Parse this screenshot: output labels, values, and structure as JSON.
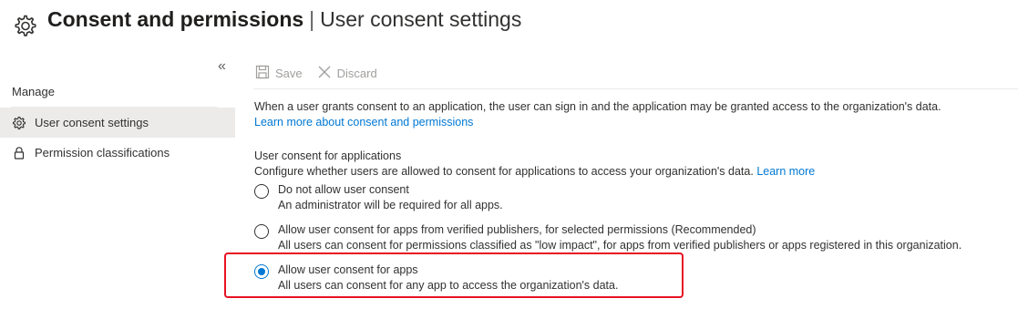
{
  "header": {
    "title": "Consent and permissions",
    "separator": "|",
    "subtitle": "User consent settings",
    "icon": "gear-icon"
  },
  "sidebar": {
    "collapse_label": "«",
    "section": "Manage",
    "items": [
      {
        "label": "User consent settings",
        "icon": "gear-icon",
        "active": true
      },
      {
        "label": "Permission classifications",
        "icon": "lock-icon",
        "active": false
      }
    ]
  },
  "toolbar": {
    "save_label": "Save",
    "discard_label": "Discard"
  },
  "main": {
    "description": "When a user grants consent to an application, the user can sign in and the application may be granted access to the organization's data.",
    "learn_more_consent": "Learn more about consent and permissions",
    "section_title": "User consent for applications",
    "section_desc": "Configure whether users are allowed to consent for applications to access your organization's data.",
    "section_learn_more": "Learn more",
    "options": [
      {
        "label": "Do not allow user consent",
        "sub": "An administrator will be required for all apps.",
        "selected": false
      },
      {
        "label": "Allow user consent for apps from verified publishers, for selected permissions (Recommended)",
        "sub": "All users can consent for permissions classified as \"low impact\", for apps from verified publishers or apps registered in this organization.",
        "selected": false
      },
      {
        "label": "Allow user consent for apps",
        "sub": "All users can consent for any app to access the organization's data.",
        "selected": true
      }
    ]
  },
  "colors": {
    "accent": "#0078d4",
    "highlight": "#e81123"
  }
}
